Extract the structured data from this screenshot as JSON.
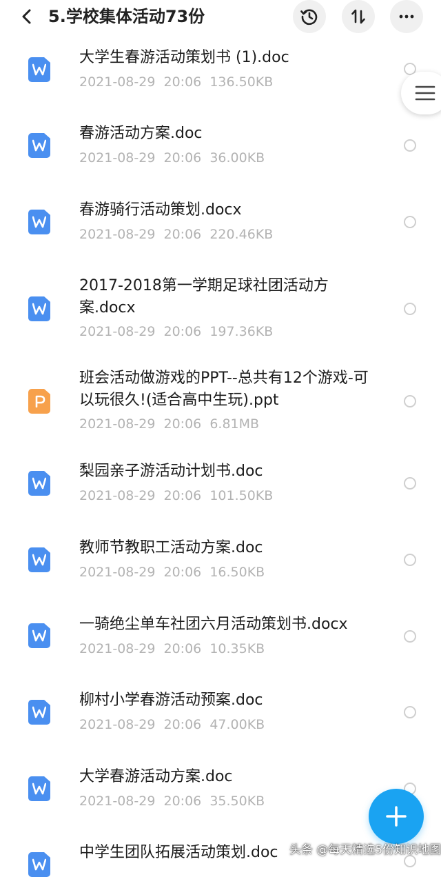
{
  "header": {
    "title": "5.学校集体活动73份",
    "back_icon": "back-arrow-icon",
    "history_icon": "history-icon",
    "sort_icon": "sort-icon",
    "more_icon": "more-dots-icon"
  },
  "files": [
    {
      "name": "大学生春游活动策划书 (1).doc",
      "meta": "2021-08-29  20:06  136.50KB",
      "type": "word"
    },
    {
      "name": "春游活动方案.doc",
      "meta": "2021-08-29  20:06  36.00KB",
      "type": "word"
    },
    {
      "name": "春游骑行活动策划.docx",
      "meta": "2021-08-29  20:06  220.46KB",
      "type": "word"
    },
    {
      "name": "2017-2018第一学期足球社团活动方案.docx",
      "meta": "2021-08-29  20:06  197.36KB",
      "type": "word"
    },
    {
      "name": "班会活动做游戏的PPT--总共有12个游戏-可以玩很久!(适合高中生玩).ppt",
      "meta": "2021-08-29  20:06  6.81MB",
      "type": "ppt"
    },
    {
      "name": "梨园亲子游活动计划书.doc",
      "meta": "2021-08-29  20:06  101.50KB",
      "type": "word"
    },
    {
      "name": "教师节教职工活动方案.doc",
      "meta": "2021-08-29  20:06  16.50KB",
      "type": "word"
    },
    {
      "name": "一骑绝尘单车社团六月活动策划书.docx",
      "meta": "2021-08-29  20:06  10.35KB",
      "type": "word"
    },
    {
      "name": "柳村小学春游活动预案.doc",
      "meta": "2021-08-29  20:06  47.00KB",
      "type": "word"
    },
    {
      "name": "大学春游活动方案.doc",
      "meta": "2021-08-29  20:06  35.50KB",
      "type": "word"
    },
    {
      "name": "中学生团队拓展活动策划.doc",
      "meta": "",
      "type": "word"
    }
  ],
  "fab": {
    "icon": "plus-icon"
  },
  "side_handle": {
    "icon": "menu-lines-icon"
  },
  "watermark": "头条 @每天精选5份知识地图",
  "colors": {
    "word_icon": "#4a8ff0",
    "ppt_icon": "#f7a14c",
    "fab": "#1aa3f2",
    "meta_text": "#b3b3b3"
  }
}
